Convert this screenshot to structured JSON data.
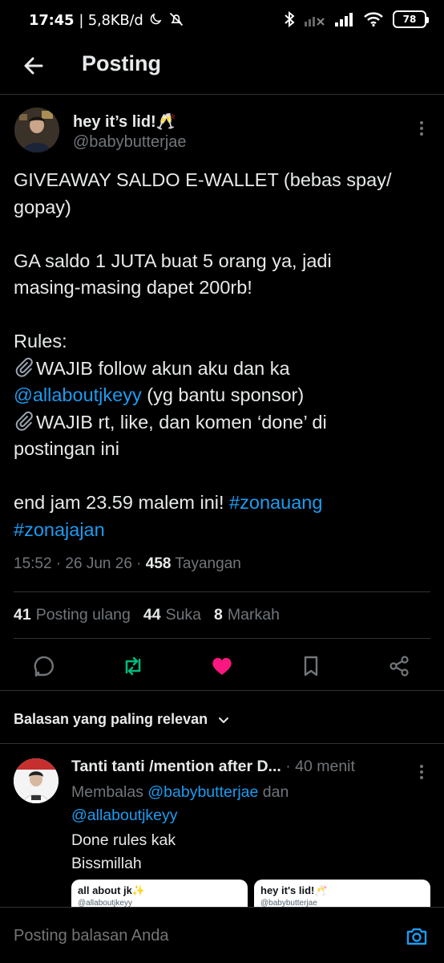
{
  "status_bar": {
    "time": "17:45",
    "net": "| 5,8KB/d",
    "battery": "78"
  },
  "header": {
    "title": "Posting"
  },
  "tweet": {
    "author_name": "hey it’s lid!🥂",
    "author_handle": "@babybutterjae",
    "line1": "GIVEAWAY SALDO E-WALLET (bebas spay/\ngopay)",
    "line2": "GA saldo 1 JUTA buat 5 orang ya, jadi\nmasing-masing dapet 200rb!",
    "rules_label": "Rules:",
    "rule1_text": "WAJIB follow akun aku dan ka",
    "rule1_mention": "@allaboutjkeyy",
    "rule1_tail": " (yg bantu sponsor)",
    "rule2_text": "WAJIB rt, like, dan komen ‘done’ di\npostingan ini",
    "end_text": "end jam 23.59 malem ini! ",
    "hashtag1": "#zonauang",
    "hashtag2": "#zonajajan",
    "meta_time": "15:52 · 26 Jun 26 · ",
    "meta_views_count": "458",
    "meta_views_label": " Tayangan"
  },
  "stats": {
    "reposts_count": "41",
    "reposts_label": "Posting ulang",
    "likes_count": "44",
    "likes_label": "Suka",
    "bookmarks_count": "8",
    "bookmarks_label": "Markah"
  },
  "colors": {
    "accent": "#1d9bf0",
    "repost_active": "#00ba7c",
    "like_active": "#f91880"
  },
  "replies_sort": {
    "label": "Balasan yang paling relevan"
  },
  "reply": {
    "name": "Tanti tanti /mention after D...",
    "time": " · 40 menit",
    "replying_label": "Membalas ",
    "replying_to1": "@babybutterjae",
    "replying_and": " dan",
    "replying_to2": "@allaboutjkeyy",
    "body": "Done rules kak\nBissmillah",
    "card1_title": "all about jk✨",
    "card1_sub": "@allaboutjkeyy",
    "card2_title": "hey it's lid!🥂",
    "card2_sub": "@babybutterjae"
  },
  "composer": {
    "placeholder": "Posting balasan Anda"
  },
  "icons": {
    "back": "arrow-left-icon",
    "more": "more-vertical-icon",
    "reply": "comment-icon",
    "repost": "repost-icon",
    "like": "heart-icon",
    "bookmark": "bookmark-icon",
    "share": "share-icon",
    "camera": "camera-icon",
    "chevron": "chevron-down-icon"
  }
}
